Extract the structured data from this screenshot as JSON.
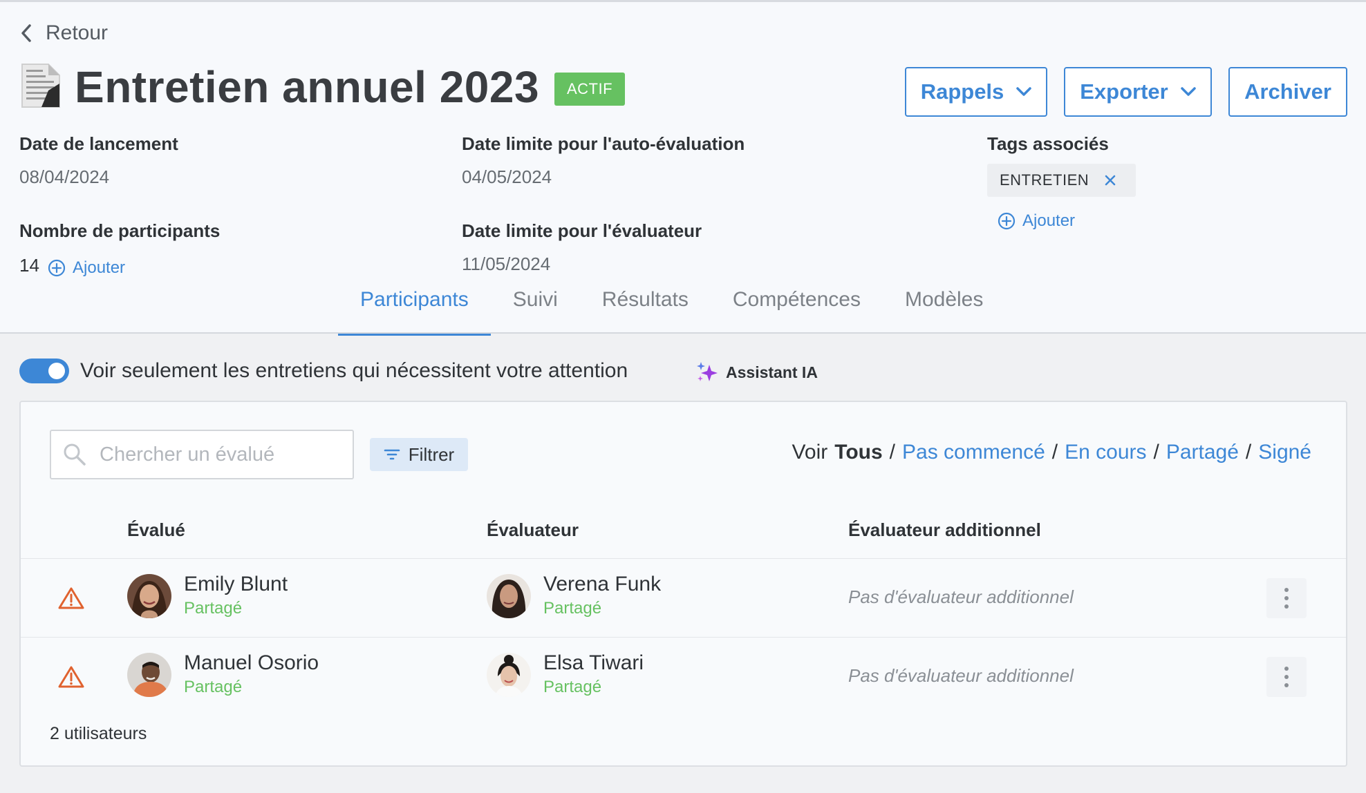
{
  "header": {
    "back_label": "Retour",
    "title": "Entretien annuel 2023",
    "status_badge": "ACTIF",
    "buttons": {
      "reminders": "Rappels",
      "export": "Exporter",
      "archive": "Archiver"
    }
  },
  "info": {
    "launch_date_label": "Date de lancement",
    "launch_date": "08/04/2024",
    "participants_label": "Nombre de participants",
    "participants_count": "14",
    "add_label": "Ajouter",
    "self_eval_deadline_label": "Date limite pour l'auto-évaluation",
    "self_eval_deadline": "04/05/2024",
    "evaluator_deadline_label": "Date limite pour l'évaluateur",
    "evaluator_deadline": "11/05/2024",
    "tags_label": "Tags associés",
    "tags": [
      "ENTRETIEN"
    ]
  },
  "tabs": [
    "Participants",
    "Suivi",
    "Résultats",
    "Compétences",
    "Modèles"
  ],
  "active_tab": "Participants",
  "filters": {
    "attention_toggle_label": "Voir seulement les entretiens qui nécessitent votre attention",
    "attention_toggle_on": true,
    "ai_assistant_label": "Assistant IA",
    "search_placeholder": "Chercher un évalué",
    "filter_button": "Filtrer",
    "view_prefix": "Voir",
    "views": [
      "Tous",
      "Pas commencé",
      "En cours",
      "Partagé",
      "Signé"
    ],
    "active_view": "Tous"
  },
  "table": {
    "columns": [
      "Évalué",
      "Évaluateur",
      "Évaluateur additionnel"
    ],
    "rows": [
      {
        "evaluee": {
          "name": "Emily Blunt",
          "status": "Partagé"
        },
        "evaluator": {
          "name": "Verena Funk",
          "status": "Partagé"
        },
        "additional": "Pas d'évaluateur additionnel"
      },
      {
        "evaluee": {
          "name": "Manuel Osorio",
          "status": "Partagé"
        },
        "evaluator": {
          "name": "Elsa Tiwari",
          "status": "Partagé"
        },
        "additional": "Pas d'évaluateur additionnel"
      }
    ],
    "count_label": "2 utilisateurs"
  },
  "colors": {
    "accent": "#3d87d6",
    "success": "#66c161",
    "warning": "#e0622f"
  }
}
